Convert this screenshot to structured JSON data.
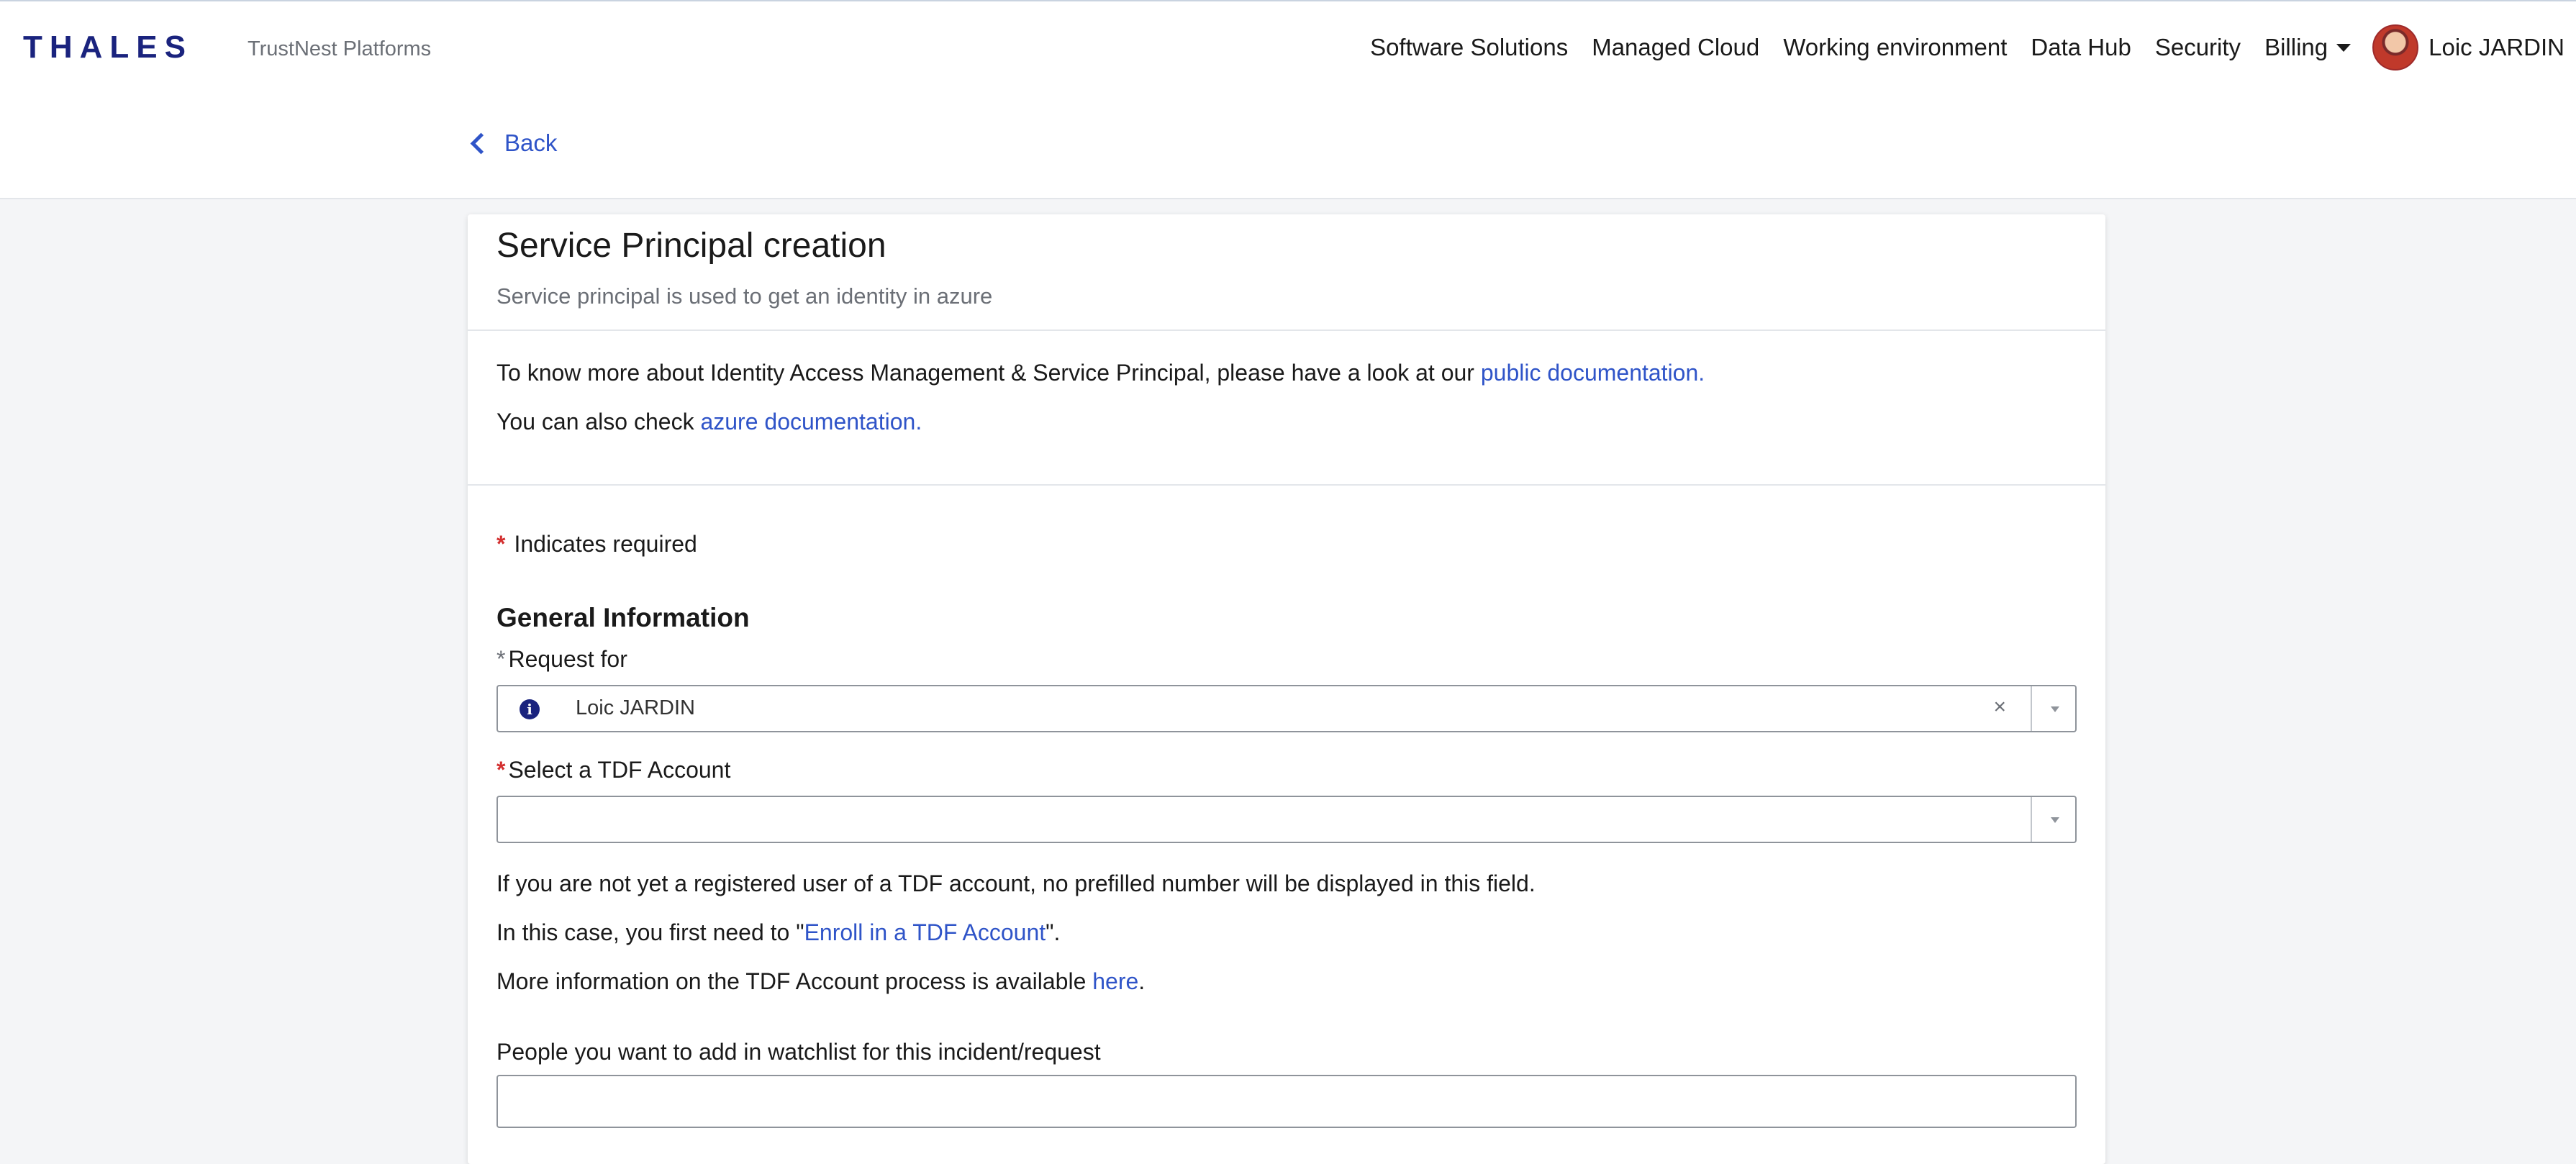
{
  "header": {
    "logo": "THALES",
    "platform": "TrustNest Platforms",
    "nav": {
      "software": "Software Solutions",
      "managed_cloud": "Managed Cloud",
      "working_env": "Working environment",
      "data_hub": "Data Hub",
      "security": "Security",
      "billing": "Billing"
    },
    "user_name": "Loic JARDIN",
    "back_label": "Back"
  },
  "card": {
    "title": "Service Principal creation",
    "subtitle": "Service principal is used to get an identity in azure",
    "info1_text": "To know more about Identity Access Management & Service Principal, please have a look at our ",
    "info1_link": "public documentation.",
    "info2_text": "You can also check ",
    "info2_link": "azure documentation."
  },
  "form": {
    "required_star": "*",
    "required_note": "Indicates required",
    "section_title": "General Information",
    "request_for_label": "Request for",
    "request_for_value": "Loic JARDIN",
    "tdf_label": "Select a TDF Account",
    "tdf_value": "",
    "help1": "If you are not yet a registered user of a TDF account, no prefilled number will be displayed in this field.",
    "help2_prefix": "In this case, you first need to \"",
    "help2_link": "Enroll in a TDF Account",
    "help2_suffix": "\".",
    "help3_prefix": "More information on the TDF Account process is available ",
    "help3_link": "here",
    "help3_suffix": ".",
    "watchlist_label": "People you want to add in watchlist for this incident/request",
    "watchlist_value": ""
  },
  "icons": {
    "back": "chevron-left-icon",
    "info": "info-circle-icon",
    "clear": "close-icon",
    "dropdown": "caret-down-icon"
  },
  "colors": {
    "brand": "#1a237e",
    "link": "#2f54c8",
    "required": "#d32f2f",
    "background": "#f4f5f7"
  }
}
